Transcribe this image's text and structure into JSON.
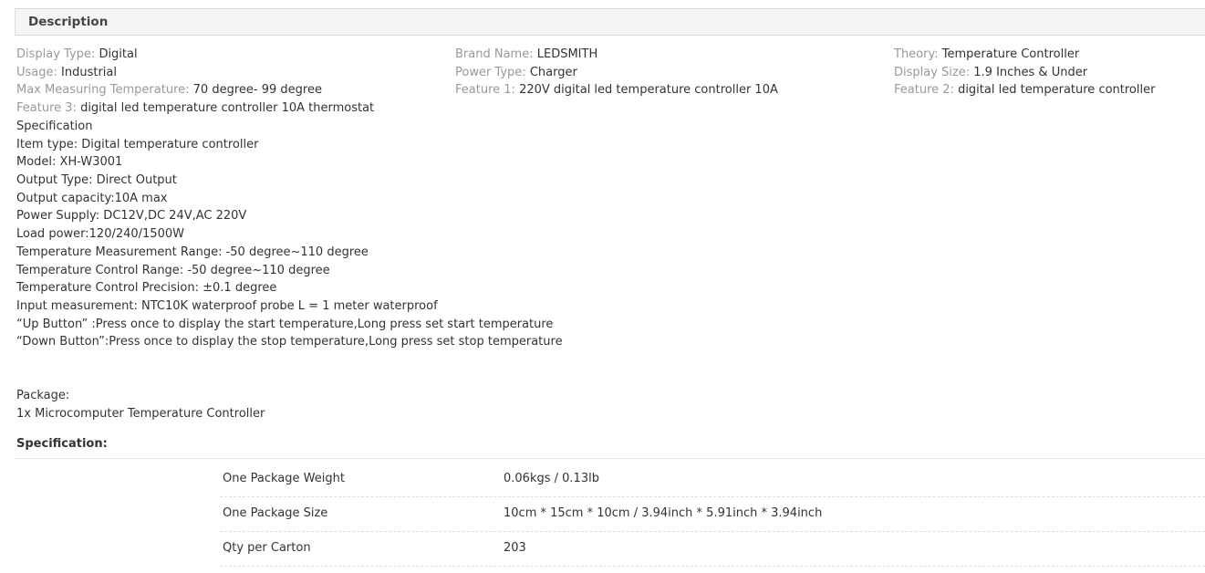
{
  "description": {
    "title": "Description"
  },
  "attributes": {
    "col1": [
      {
        "name": "Display Type:",
        "value": "Digital"
      },
      {
        "name": "Usage:",
        "value": "Industrial"
      },
      {
        "name": "Max Measuring Temperature:",
        "value": "70 degree- 99 degree"
      },
      {
        "name": "Feature 3:",
        "value": "digital led temperature controller 10A thermostat"
      }
    ],
    "col2": [
      {
        "name": "Brand Name:",
        "value": "LEDSMITH"
      },
      {
        "name": "Power Type:",
        "value": "Charger"
      },
      {
        "name": "Feature 1:",
        "value": "220V digital led temperature controller 10A"
      }
    ],
    "col3": [
      {
        "name": "Theory:",
        "value": "Temperature Controller"
      },
      {
        "name": "Display Size:",
        "value": "1.9 Inches & Under"
      },
      {
        "name": "Feature 2:",
        "value": "digital led temperature controller"
      }
    ]
  },
  "spec_text": [
    "Specification",
    "Item type: Digital temperature controller",
    "Model: XH-W3001",
    "Output Type: Direct Output",
    "Output capacity:10A max",
    "Power Supply: DC12V,DC 24V,AC 220V",
    "Load power:120/240/1500W",
    "Temperature Measurement Range: -50 degree~110 degree",
    "Temperature Control Range: -50 degree~110 degree",
    "Temperature Control Precision: ±0.1 degree",
    "Input measurement: NTC10K waterproof probe L = 1 meter waterproof",
    "“Up Button” :Press once to display the start temperature,Long press set start temperature",
    "“Down Button”:Press once to display the stop temperature,Long press set stop temperature"
  ],
  "package": {
    "label": "Package:",
    "content": "1x Microcomputer Temperature Controller"
  },
  "specification": {
    "title": "Specification:",
    "rows": [
      {
        "label": "One Package Weight",
        "value": "0.06kgs / 0.13lb"
      },
      {
        "label": "One Package Size",
        "value": "10cm * 15cm * 10cm / 3.94inch * 5.91inch * 3.94inch"
      },
      {
        "label": "Qty per Carton",
        "value": "203"
      }
    ]
  }
}
